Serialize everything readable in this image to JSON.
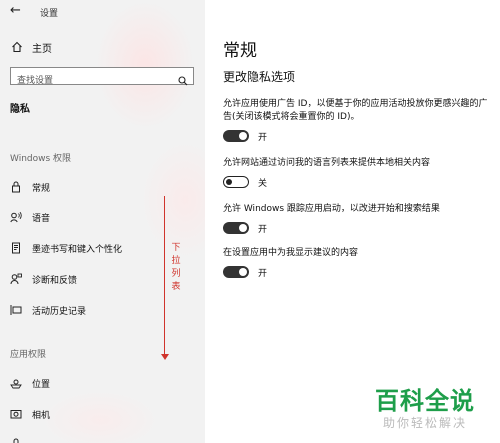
{
  "window": {
    "title": "设置"
  },
  "sidebar": {
    "home_label": "主页",
    "search_placeholder": "查找设置",
    "current_section": "隐私",
    "group_windows": "Windows 权限",
    "windows_items": [
      {
        "label": "常规",
        "icon": "lock-icon"
      },
      {
        "label": "语音",
        "icon": "speech-icon"
      },
      {
        "label": "墨迹书写和键入个性化",
        "icon": "pen-document-icon"
      },
      {
        "label": "诊断和反馈",
        "icon": "feedback-icon"
      },
      {
        "label": "活动历史记录",
        "icon": "timeline-icon"
      }
    ],
    "group_app": "应用权限",
    "app_items": [
      {
        "label": "位置",
        "icon": "location-icon"
      },
      {
        "label": "相机",
        "icon": "camera-icon"
      }
    ]
  },
  "annotation": {
    "text": "下拉列表",
    "color": "#d0342c"
  },
  "main": {
    "title": "常规",
    "subtitle": "更改隐私选项",
    "settings": [
      {
        "desc_lines": [
          "允许应用使用广告 ID，以便基于你的应用活动投放你更感兴趣的广",
          "告(关闭该模式将会重置你的 ID)。"
        ],
        "on": true,
        "state_label": "开"
      },
      {
        "desc_lines": [
          "允许网站通过访问我的语言列表来提供本地相关内容"
        ],
        "on": false,
        "state_label": "关"
      },
      {
        "desc_lines": [
          "允许 Windows 跟踪应用启动，以改进开始和搜索结果"
        ],
        "on": true,
        "state_label": "开"
      },
      {
        "desc_lines": [
          "在设置应用中为我显示建议的内容"
        ],
        "on": true,
        "state_label": "开"
      }
    ]
  },
  "watermark": {
    "brand": "百科全说",
    "slogan": "助你轻松解决",
    "brand_color": "#1e9e4a"
  }
}
